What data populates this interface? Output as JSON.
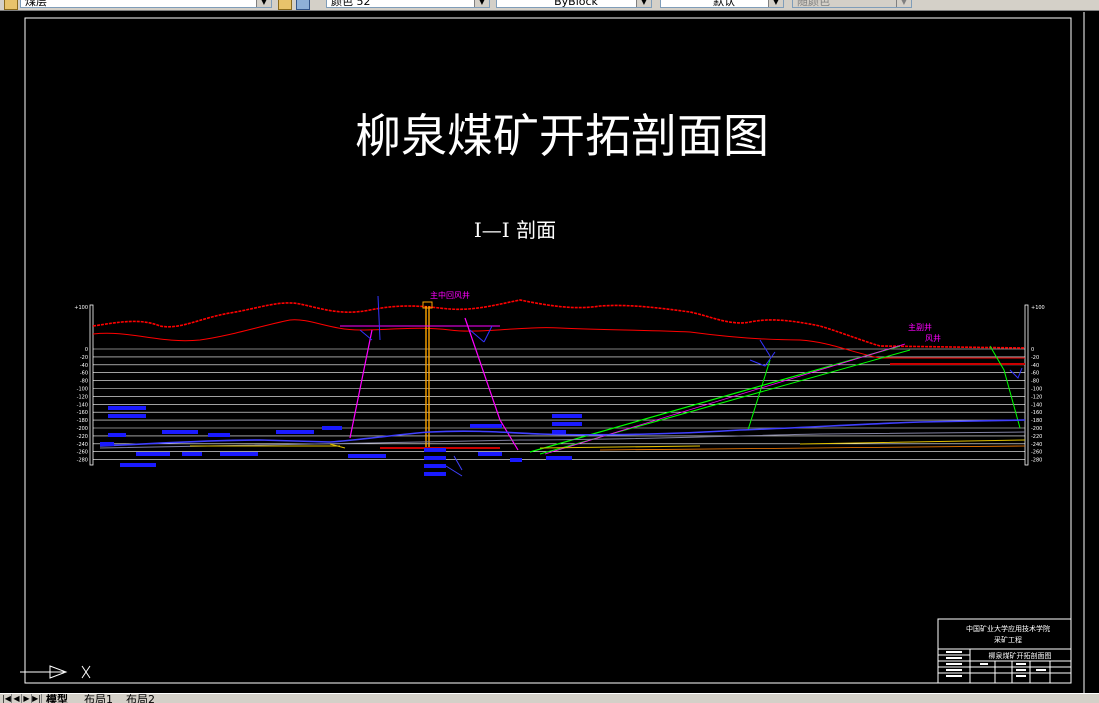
{
  "toolbar": {
    "layer_value": "煤层",
    "color_value": "颜色 52",
    "linetype_value": "ByBlock",
    "lineweight_value": "默认",
    "plotstyle_value": "随颜色"
  },
  "drawing": {
    "title": "柳泉煤矿开拓剖面图",
    "section_label": "I—I   剖面",
    "shaft_label": "主中回风井",
    "main_shaft_label": "主副井",
    "air_shaft_label": "风井",
    "axis_ticks_left": [
      "+100",
      "0",
      "-20",
      "-40",
      "-60",
      "-80",
      "-100",
      "-120",
      "-140",
      "-160",
      "-180",
      "-200",
      "-220",
      "-240",
      "-260",
      "-280"
    ],
    "axis_ticks_right": [
      "+100",
      "0",
      "-20",
      "-40",
      "-60",
      "-80",
      "-100",
      "-120",
      "-140",
      "-160",
      "-180",
      "-200",
      "-220",
      "-240",
      "-260",
      "-280"
    ],
    "title_block": {
      "school": "中国矿业大学应用技术学院",
      "major": "采矿工程",
      "drawing_name": "柳泉煤矿开拓剖面图"
    }
  },
  "tabs": {
    "model": "模型",
    "layout1": "布局1",
    "layout2": "布局2"
  },
  "colors": {
    "background": "#000000",
    "surface": "#ff0000",
    "shaft_magenta": "#ff00ff",
    "roadway_blue": "#0000ff",
    "incline_green": "#00ff00",
    "grid": "#ffffff",
    "main_shaft": "#ffa500"
  }
}
